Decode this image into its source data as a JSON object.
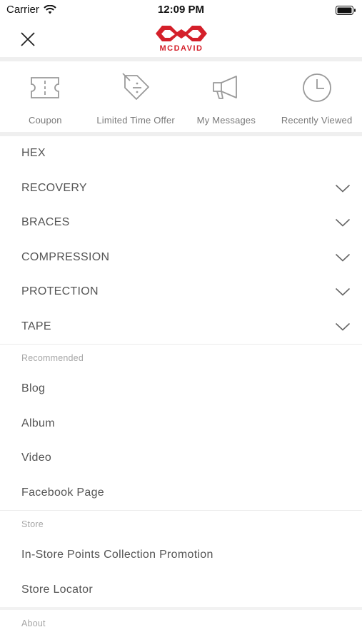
{
  "status_bar": {
    "carrier": "Carrier",
    "time": "12:09 PM"
  },
  "header": {
    "logo_text": "MCDAVID"
  },
  "colors": {
    "brand_red": "#d4202a",
    "text": "#555555",
    "muted": "#a6a6a6"
  },
  "quick_links": [
    {
      "label": "Coupon",
      "icon": "ticket-icon"
    },
    {
      "label": "Limited Time Offer",
      "icon": "price-tag-icon"
    },
    {
      "label": "My Messages",
      "icon": "megaphone-icon"
    },
    {
      "label": "Recently Viewed",
      "icon": "clock-icon"
    }
  ],
  "categories": [
    {
      "label": "HEX",
      "expandable": false
    },
    {
      "label": "RECOVERY",
      "expandable": true
    },
    {
      "label": "BRACES",
      "expandable": true
    },
    {
      "label": "COMPRESSION",
      "expandable": true
    },
    {
      "label": "PROTECTION",
      "expandable": true
    },
    {
      "label": "TAPE",
      "expandable": true
    }
  ],
  "recommended": {
    "title": "Recommended",
    "items": [
      "Blog",
      "Album",
      "Video",
      "Facebook Page"
    ]
  },
  "store": {
    "title": "Store",
    "items": [
      "In-Store Points Collection Promotion",
      "Store Locator"
    ]
  },
  "about": {
    "title": "About"
  }
}
